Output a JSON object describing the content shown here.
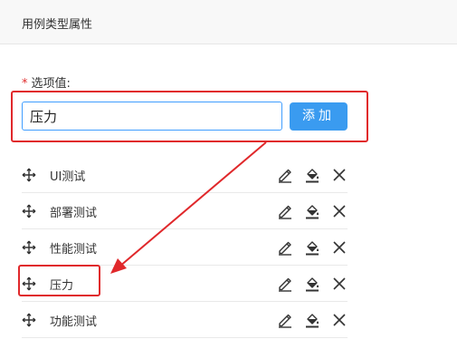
{
  "header": {
    "title": "用例类型属性"
  },
  "form": {
    "label": "选项值:",
    "required_mark": "*",
    "input_value": "压力",
    "add_label": "添加"
  },
  "options": [
    {
      "label": "UI测试"
    },
    {
      "label": "部署测试"
    },
    {
      "label": "性能测试"
    },
    {
      "label": "压力"
    },
    {
      "label": "功能测试"
    }
  ],
  "icons": {
    "drag": "drag-handle-icon",
    "edit": "edit-pencil-icon",
    "fill": "paint-bucket-icon",
    "delete": "close-icon"
  },
  "colors": {
    "primary": "#3a9bf0",
    "input_border": "#409eff",
    "annotation": "#e0282b",
    "required": "#e02b2b"
  }
}
